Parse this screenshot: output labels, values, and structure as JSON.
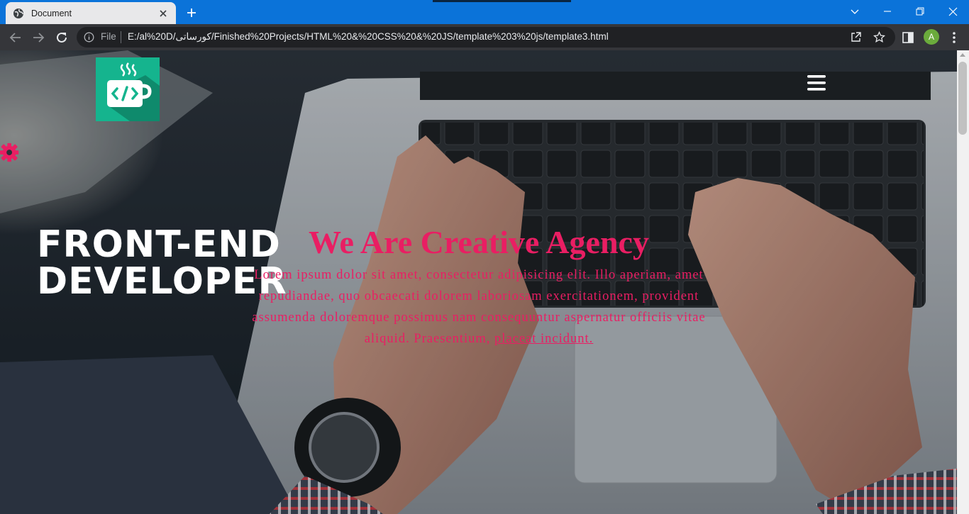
{
  "browser": {
    "tab_title": "Document",
    "address_prefix": "File",
    "url": "E:/al%20D/کورساتی/Finished%20Projects/HTML%20&%20CSS%20&%20JS/template%203%20js/template3.html",
    "profile_initial": "A"
  },
  "page": {
    "brand_line_1": "FRONT-END",
    "brand_line_2": "DEVELOPER",
    "headline": "We Are Creative Agency",
    "lead_text": "Lorem ipsum dolor sit amet, consectetur adipisicing elit. Illo aperiam, amet repudiandae, quo obcaecati dolorem laboriosam exercitationem, provident assumenda doloremque possimus nam consequuntur aspernatur officiis vitae aliquid. Praesentium, ",
    "lead_link": "placeat incidunt."
  },
  "colors": {
    "accent": "#e91e63",
    "logo_bg": "#15b48e",
    "chrome_titlebar": "#0b73d9",
    "chrome_toolbar": "#35363a"
  },
  "icons": [
    "globe-icon",
    "close-icon",
    "plus-icon",
    "chevron-down-icon",
    "minimize-icon",
    "restore-icon",
    "back-arrow-icon",
    "forward-arrow-icon",
    "reload-icon",
    "info-icon",
    "share-icon",
    "star-icon",
    "sidebar-icon",
    "kebab-menu-icon",
    "code-logo-icon",
    "hamburger-menu-icon",
    "gear-icon"
  ]
}
